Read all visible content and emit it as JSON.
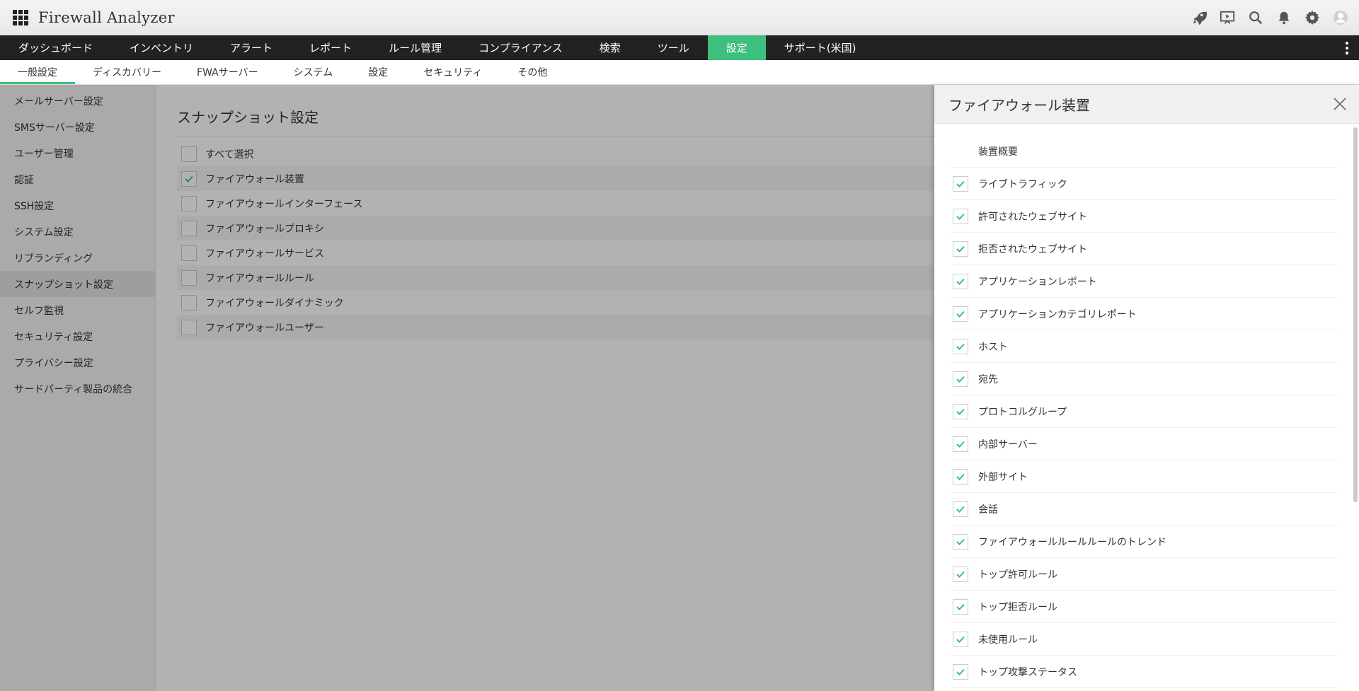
{
  "app": {
    "title": "Firewall Analyzer"
  },
  "header": {
    "icons": [
      "rocket-icon",
      "presentation-icon",
      "search-icon",
      "bell-icon",
      "gear-icon",
      "user-avatar-icon"
    ]
  },
  "main_nav": {
    "items": [
      {
        "label": "ダッシュボード"
      },
      {
        "label": "インベントリ"
      },
      {
        "label": "アラート"
      },
      {
        "label": "レポート"
      },
      {
        "label": "ルール管理"
      },
      {
        "label": "コンプライアンス"
      },
      {
        "label": "検索"
      },
      {
        "label": "ツール"
      },
      {
        "label": "設定",
        "active": true
      },
      {
        "label": "サポート(米国)"
      }
    ]
  },
  "sub_nav": {
    "items": [
      {
        "label": "一般設定",
        "active": true
      },
      {
        "label": "ディスカバリー"
      },
      {
        "label": "FWAサーバー"
      },
      {
        "label": "システム"
      },
      {
        "label": "設定"
      },
      {
        "label": "セキュリティ"
      },
      {
        "label": "その他"
      }
    ]
  },
  "sidebar": {
    "items": [
      {
        "label": "メールサーバー設定"
      },
      {
        "label": "SMSサーバー設定"
      },
      {
        "label": "ユーザー管理"
      },
      {
        "label": "認証"
      },
      {
        "label": "SSH設定"
      },
      {
        "label": "システム設定"
      },
      {
        "label": "リブランディング"
      },
      {
        "label": "スナップショット設定",
        "active": true
      },
      {
        "label": "セルフ監視"
      },
      {
        "label": "セキュリティ設定"
      },
      {
        "label": "プライバシー設定"
      },
      {
        "label": "サードパーティ製品の統合"
      }
    ]
  },
  "content": {
    "title": "スナップショット設定",
    "options": [
      {
        "label": "すべて選択",
        "checked": false
      },
      {
        "label": "ファイアウォール装置",
        "checked": true
      },
      {
        "label": "ファイアウォールインターフェース",
        "checked": false
      },
      {
        "label": "ファイアウォールプロキシ",
        "checked": false
      },
      {
        "label": "ファイアウォールサービス",
        "checked": false
      },
      {
        "label": "ファイアウォールルール",
        "checked": false
      },
      {
        "label": "ファイアウォールダイナミック",
        "checked": false
      },
      {
        "label": "ファイアウォールユーザー",
        "checked": false
      }
    ]
  },
  "panel": {
    "title": "ファイアウォール装置",
    "section_label": "装置概要",
    "items": [
      {
        "label": "ライブトラフィック",
        "checked": true
      },
      {
        "label": "許可されたウェブサイト",
        "checked": true
      },
      {
        "label": "拒否されたウェブサイト",
        "checked": true
      },
      {
        "label": "アプリケーションレポート",
        "checked": true
      },
      {
        "label": "アプリケーションカテゴリレポート",
        "checked": true
      },
      {
        "label": "ホスト",
        "checked": true
      },
      {
        "label": "宛先",
        "checked": true
      },
      {
        "label": "プロトコルグループ",
        "checked": true
      },
      {
        "label": "内部サーバー",
        "checked": true
      },
      {
        "label": "外部サイト",
        "checked": true
      },
      {
        "label": "会話",
        "checked": true
      },
      {
        "label": "ファイアウォールルールルールのトレンド",
        "checked": true
      },
      {
        "label": "トップ許可ルール",
        "checked": true
      },
      {
        "label": "トップ拒否ルール",
        "checked": true
      },
      {
        "label": "未使用ルール",
        "checked": true
      },
      {
        "label": "トップ攻撃ステータス",
        "checked": true
      }
    ]
  },
  "colors": {
    "accent": "#3dbf7e",
    "nav_bg": "#222222"
  }
}
